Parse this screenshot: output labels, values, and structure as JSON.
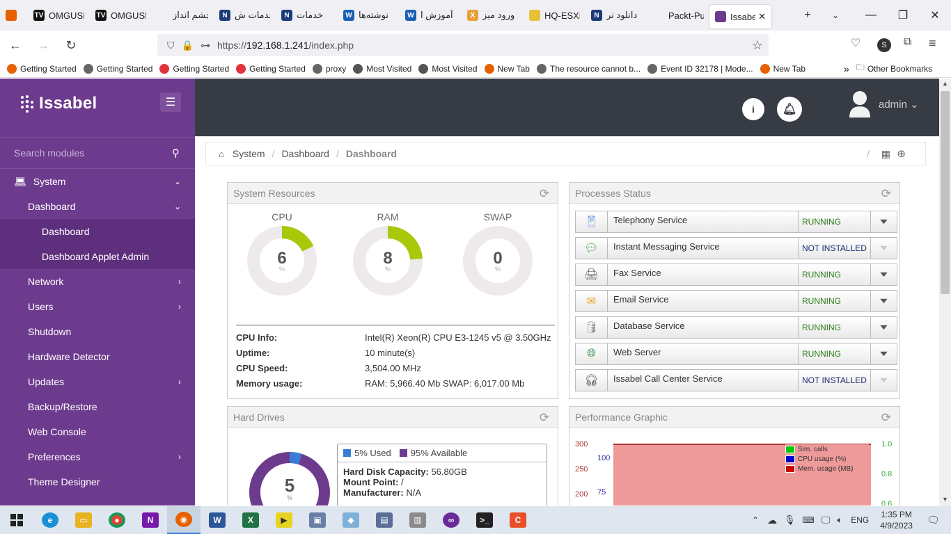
{
  "browser": {
    "tabs": [
      {
        "label": "",
        "color": "#e66000",
        "letter": ""
      },
      {
        "label": "OMGUSI",
        "color": "#111111",
        "letter": "TV"
      },
      {
        "label": "OMGUSI",
        "color": "#111111",
        "letter": "TV"
      },
      {
        "label": "گروه چشم انداز",
        "color": "#f0f0f4",
        "letter": ""
      },
      {
        "label": "خدمات ش",
        "color": "#1d3b7a",
        "letter": "N"
      },
      {
        "label": "خدمات",
        "color": "#1d3b7a",
        "letter": "N"
      },
      {
        "label": "نوشته‌ها",
        "color": "#1a5fb4",
        "letter": "W"
      },
      {
        "label": "آموزش ا",
        "color": "#1a5fb4",
        "letter": "W"
      },
      {
        "label": "ورود میز",
        "color": "#e8a03a",
        "letter": "X"
      },
      {
        "label": "HQ-ESXi",
        "color": "#e8c03a",
        "letter": ""
      },
      {
        "label": "دانلود نر",
        "color": "#1d3b7a",
        "letter": "N"
      },
      {
        "label": "Packt-Publis",
        "color": "#f0f0f4",
        "letter": ""
      },
      {
        "label": "Issabe",
        "color": "#6d3b8e",
        "letter": ""
      }
    ],
    "url_prefix": "https://",
    "url_host": "192.168.1.241",
    "url_path": "/index.php",
    "bookmarks": [
      {
        "label": "Getting Started",
        "color": "#e66000"
      },
      {
        "label": "Getting Started",
        "color": "#666666"
      },
      {
        "label": "Getting Started",
        "color": "#e0323a"
      },
      {
        "label": "Getting Started",
        "color": "#e0323a"
      },
      {
        "label": "proxy",
        "color": "#666666"
      },
      {
        "label": "Most Visited",
        "color": "#555555"
      },
      {
        "label": "Most Visited",
        "color": "#555555"
      },
      {
        "label": "New Tab",
        "color": "#e66000"
      },
      {
        "label": "The resource cannot b...",
        "color": "#666666"
      },
      {
        "label": "Event ID 32178 | Mode...",
        "color": "#666666"
      },
      {
        "label": "New Tab",
        "color": "#e66000"
      }
    ],
    "other_bookmarks": "Other Bookmarks",
    "profile_letter": "S"
  },
  "sidebar": {
    "brand": "Issabel",
    "search_placeholder": "Search modules",
    "items": [
      {
        "label": "System",
        "level": 0,
        "arrow": "⌄"
      },
      {
        "label": "Dashboard",
        "level": 1,
        "arrow": "⌄"
      },
      {
        "label": "Dashboard",
        "level": 2,
        "arrow": ""
      },
      {
        "label": "Dashboard Applet Admin",
        "level": 2,
        "arrow": ""
      },
      {
        "label": "Network",
        "level": 1,
        "arrow": "›"
      },
      {
        "label": "Users",
        "level": 1,
        "arrow": "›"
      },
      {
        "label": "Shutdown",
        "level": 1,
        "arrow": ""
      },
      {
        "label": "Hardware Detector",
        "level": 1,
        "arrow": ""
      },
      {
        "label": "Updates",
        "level": 1,
        "arrow": "›"
      },
      {
        "label": "Backup/Restore",
        "level": 1,
        "arrow": ""
      },
      {
        "label": "Web Console",
        "level": 1,
        "arrow": ""
      },
      {
        "label": "Preferences",
        "level": 1,
        "arrow": "›"
      },
      {
        "label": "Theme Designer",
        "level": 1,
        "arrow": ""
      }
    ]
  },
  "header": {
    "user": "admin"
  },
  "breadcrumb": [
    "System",
    "Dashboard",
    "Dashboard"
  ],
  "system_resources": {
    "title": "System Resources",
    "gauges": [
      {
        "label": "CPU",
        "value": "6",
        "unit": "%",
        "fraction": 0.06
      },
      {
        "label": "RAM",
        "value": "8",
        "unit": "%",
        "fraction": 0.08
      },
      {
        "label": "SWAP",
        "value": "0",
        "unit": "%",
        "fraction": 0.0
      }
    ],
    "info": [
      {
        "key": "CPU Info:",
        "value": "Intel(R) Xeon(R) CPU E3-1245 v5 @ 3.50GHz"
      },
      {
        "key": "Uptime:",
        "value": "10 minute(s)"
      },
      {
        "key": "CPU Speed:",
        "value": "3,504.00 MHz"
      },
      {
        "key": "Memory usage:",
        "value": "RAM: 5,966.40 Mb SWAP: 6,017.00 Mb"
      }
    ]
  },
  "processes": {
    "title": "Processes Status",
    "items": [
      {
        "name": "Telephony Service",
        "status": "RUNNING",
        "icon": "phone-icon"
      },
      {
        "name": "Instant Messaging Service",
        "status": "NOT INSTALLED",
        "icon": "chat-icon"
      },
      {
        "name": "Fax Service",
        "status": "RUNNING",
        "icon": "fax-icon"
      },
      {
        "name": "Email Service",
        "status": "RUNNING",
        "icon": "envelope-icon"
      },
      {
        "name": "Database Service",
        "status": "RUNNING",
        "icon": "database-icon"
      },
      {
        "name": "Web Server",
        "status": "RUNNING",
        "icon": "globe-icon"
      },
      {
        "name": "Issabel Call Center Service",
        "status": "NOT INSTALLED",
        "icon": "headset-icon"
      }
    ],
    "colors": {
      "running": "#2e7d1a",
      "not_installed": "#1a2a6e"
    }
  },
  "hard_drives": {
    "title": "Hard Drives",
    "used_legend": "5% Used",
    "available_legend": "95% Available",
    "used_fraction": 0.05,
    "center_value": "5",
    "center_unit": "%",
    "capacity_key": "Hard Disk Capacity:",
    "capacity_value": "56.80GB",
    "mount_key": "Mount Point:",
    "mount_value": "/",
    "manufacturer_key": "Manufacturer:",
    "manufacturer_value": "N/A"
  },
  "performance": {
    "title": "Performance Graphic",
    "left_ticks": [
      "300",
      "250",
      "200"
    ],
    "inner_ticks": [
      "100",
      "75"
    ],
    "right_ticks": [
      "1.0",
      "0.8",
      "0.6"
    ],
    "legend": [
      {
        "label": "Sim. calls",
        "color": "#00cc00"
      },
      {
        "label": "CPU usage (%)",
        "color": "#0000cc"
      },
      {
        "label": "Mem. usage (MB)",
        "color": "#cc0000"
      }
    ]
  },
  "taskbar": {
    "lang": "ENG",
    "time": "1:35 PM",
    "date": "4/9/2023"
  }
}
